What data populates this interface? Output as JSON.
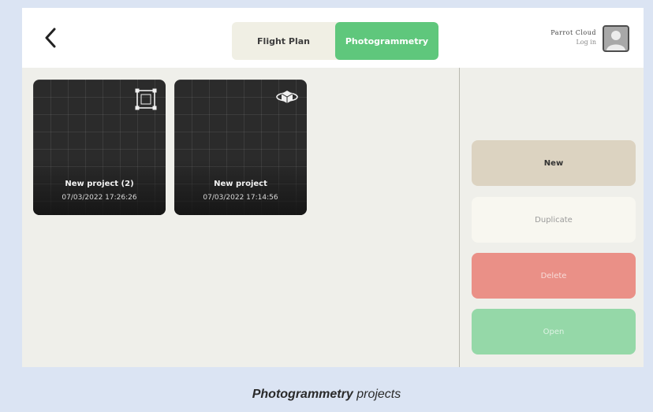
{
  "header": {
    "tabs": [
      {
        "label": "Flight Plan",
        "active": false
      },
      {
        "label": "Photogrammetry",
        "active": true
      }
    ],
    "cloud_brand": "Parrot Cloud",
    "login_label": "Log in"
  },
  "projects": [
    {
      "title": "New project (2)",
      "date": "07/03/2022 17:26:26",
      "icon": "polygon-grid-icon"
    },
    {
      "title": "New project",
      "date": "07/03/2022 17:14:56",
      "icon": "orbit-cube-icon"
    }
  ],
  "actions": {
    "new_label": "New",
    "duplicate_label": "Duplicate",
    "delete_label": "Delete",
    "open_label": "Open"
  },
  "caption": {
    "bold": "Photogrammetry",
    "rest": "projects"
  },
  "colors": {
    "accent_green": "#5fc77c",
    "delete_red": "#ea9087",
    "open_green": "#95d8a8",
    "new_beige": "#dcd3c1"
  }
}
